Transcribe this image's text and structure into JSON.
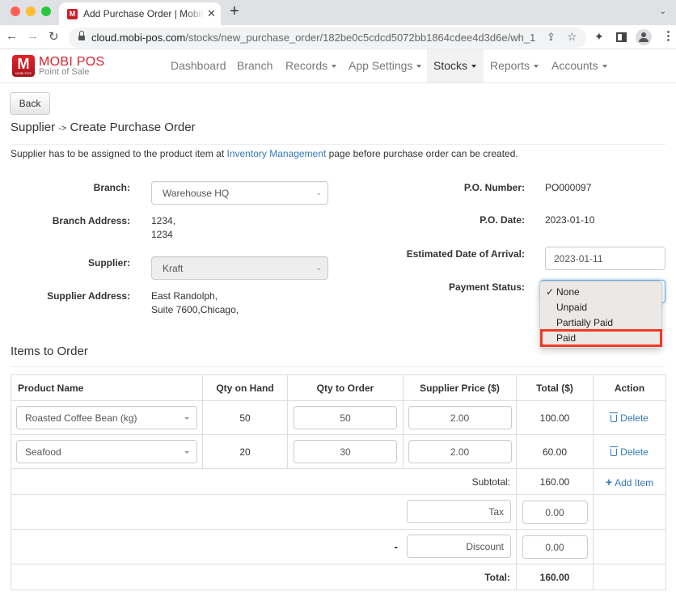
{
  "browser": {
    "tab_title": "Add Purchase Order | MobiPOS",
    "tab_favicon": "M",
    "url_host": "cloud.mobi-pos.com",
    "url_path": "/stocks/new_purchase_order/182be0c5cdcd5072bb1864cdee4d3d6e/wh_1"
  },
  "app": {
    "logo_title": "MOBI POS",
    "logo_subtitle": "Point of Sale",
    "logo_letter": "M",
    "logo_mini": "MOBI POS",
    "nav": [
      {
        "label": "Dashboard",
        "dropdown": false
      },
      {
        "label": "Branch",
        "dropdown": false
      },
      {
        "label": "Records",
        "dropdown": true
      },
      {
        "label": "App Settings",
        "dropdown": true
      },
      {
        "label": "Stocks",
        "dropdown": true,
        "active": true
      },
      {
        "label": "Reports",
        "dropdown": true
      },
      {
        "label": "Accounts",
        "dropdown": true
      }
    ]
  },
  "page": {
    "back_label": "Back",
    "title_part1": "Supplier",
    "title_arrow": "->",
    "title_part2": "Create Purchase Order",
    "notice_before": "Supplier has to be assigned to the product item at ",
    "notice_link": "Inventory Management",
    "notice_after": " page before purchase order can be created."
  },
  "form": {
    "branch_label": "Branch:",
    "branch_value": "Warehouse HQ",
    "branch_address_label": "Branch Address:",
    "branch_address_line1": "1234,",
    "branch_address_line2": "1234",
    "supplier_label": "Supplier:",
    "supplier_value": "Kraft",
    "supplier_address_label": "Supplier Address:",
    "supplier_address_line1": "East Randolph,",
    "supplier_address_line2": "Suite 7600,Chicago,",
    "po_number_label": "P.O. Number:",
    "po_number_value": "PO000097",
    "po_date_label": "P.O. Date:",
    "po_date_value": "2023-01-10",
    "eta_label": "Estimated Date of Arrival:",
    "eta_value": "2023-01-11",
    "payment_status_label": "Payment Status:",
    "payment_status_options": [
      {
        "label": "None",
        "checked": true
      },
      {
        "label": "Unpaid",
        "checked": false
      },
      {
        "label": "Partially Paid",
        "checked": false
      },
      {
        "label": "Paid",
        "checked": false,
        "highlighted": true
      }
    ],
    "highlight_color": "#f03a23"
  },
  "items": {
    "section_title": "Items to Order",
    "columns": [
      "Product Name",
      "Qty on Hand",
      "Qty to Order",
      "Supplier Price ($)",
      "Total ($)",
      "Action"
    ],
    "rows": [
      {
        "product": "Roasted Coffee Bean (kg)",
        "qty_on_hand": "50",
        "qty_to_order": "50",
        "supplier_price": "2.00",
        "total": "100.00",
        "action": "Delete"
      },
      {
        "product": "Seafood",
        "qty_on_hand": "20",
        "qty_to_order": "30",
        "supplier_price": "2.00",
        "total": "60.00",
        "action": "Delete"
      }
    ],
    "subtotal_label": "Subtotal:",
    "subtotal_value": "160.00",
    "add_item_label": "Add Item",
    "tax_label": "Tax",
    "tax_value": "0.00",
    "discount_sign": "-",
    "discount_label": "Discount",
    "discount_value": "0.00",
    "total_label": "Total:",
    "total_value": "160.00"
  },
  "colors": {
    "brand_red": "#d9232c",
    "link_blue": "#337ab7"
  }
}
